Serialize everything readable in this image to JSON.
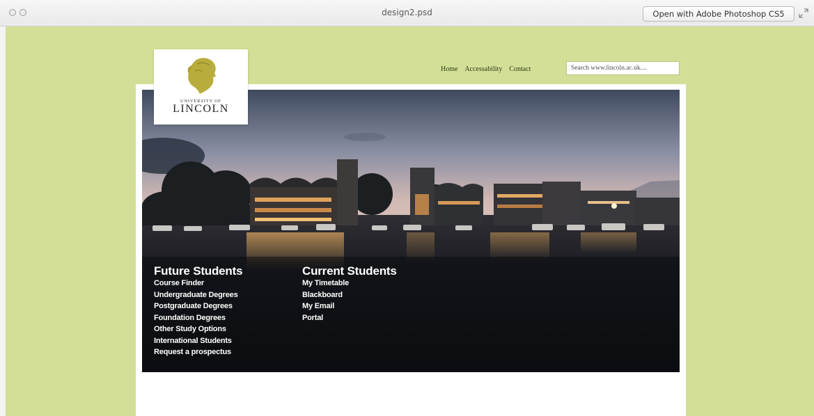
{
  "window": {
    "title": "design2.psd",
    "open_button_label": "Open with Adobe Photoshop CS5"
  },
  "site": {
    "logo": {
      "line1": "UNIVERSITY OF",
      "line2": "LINCOLN"
    },
    "nav": [
      "Home",
      "Accessability",
      "Contact"
    ],
    "search_value": "Search www.lincoln.ac.uk....",
    "future_students": {
      "heading": "Future Students",
      "links": [
        "Course Finder",
        "Undergraduate Degrees",
        "Postgraduate Degrees",
        "Foundation Degrees",
        "Other Study Options",
        "International Students",
        "Request a prospectus"
      ]
    },
    "current_students": {
      "heading": "Current Students",
      "links": [
        "My Timetable",
        "Blackboard",
        "My Email",
        "Portal"
      ]
    }
  },
  "colors": {
    "canvas_background": "#d3df96",
    "logo_gold": "#b8ad3c",
    "link_text": "#ffffff"
  },
  "icons": {
    "window_controls": [
      "close-icon",
      "minimize-icon"
    ],
    "fullscreen": "expand-arrows-icon",
    "logo": "minerva-head-icon"
  }
}
